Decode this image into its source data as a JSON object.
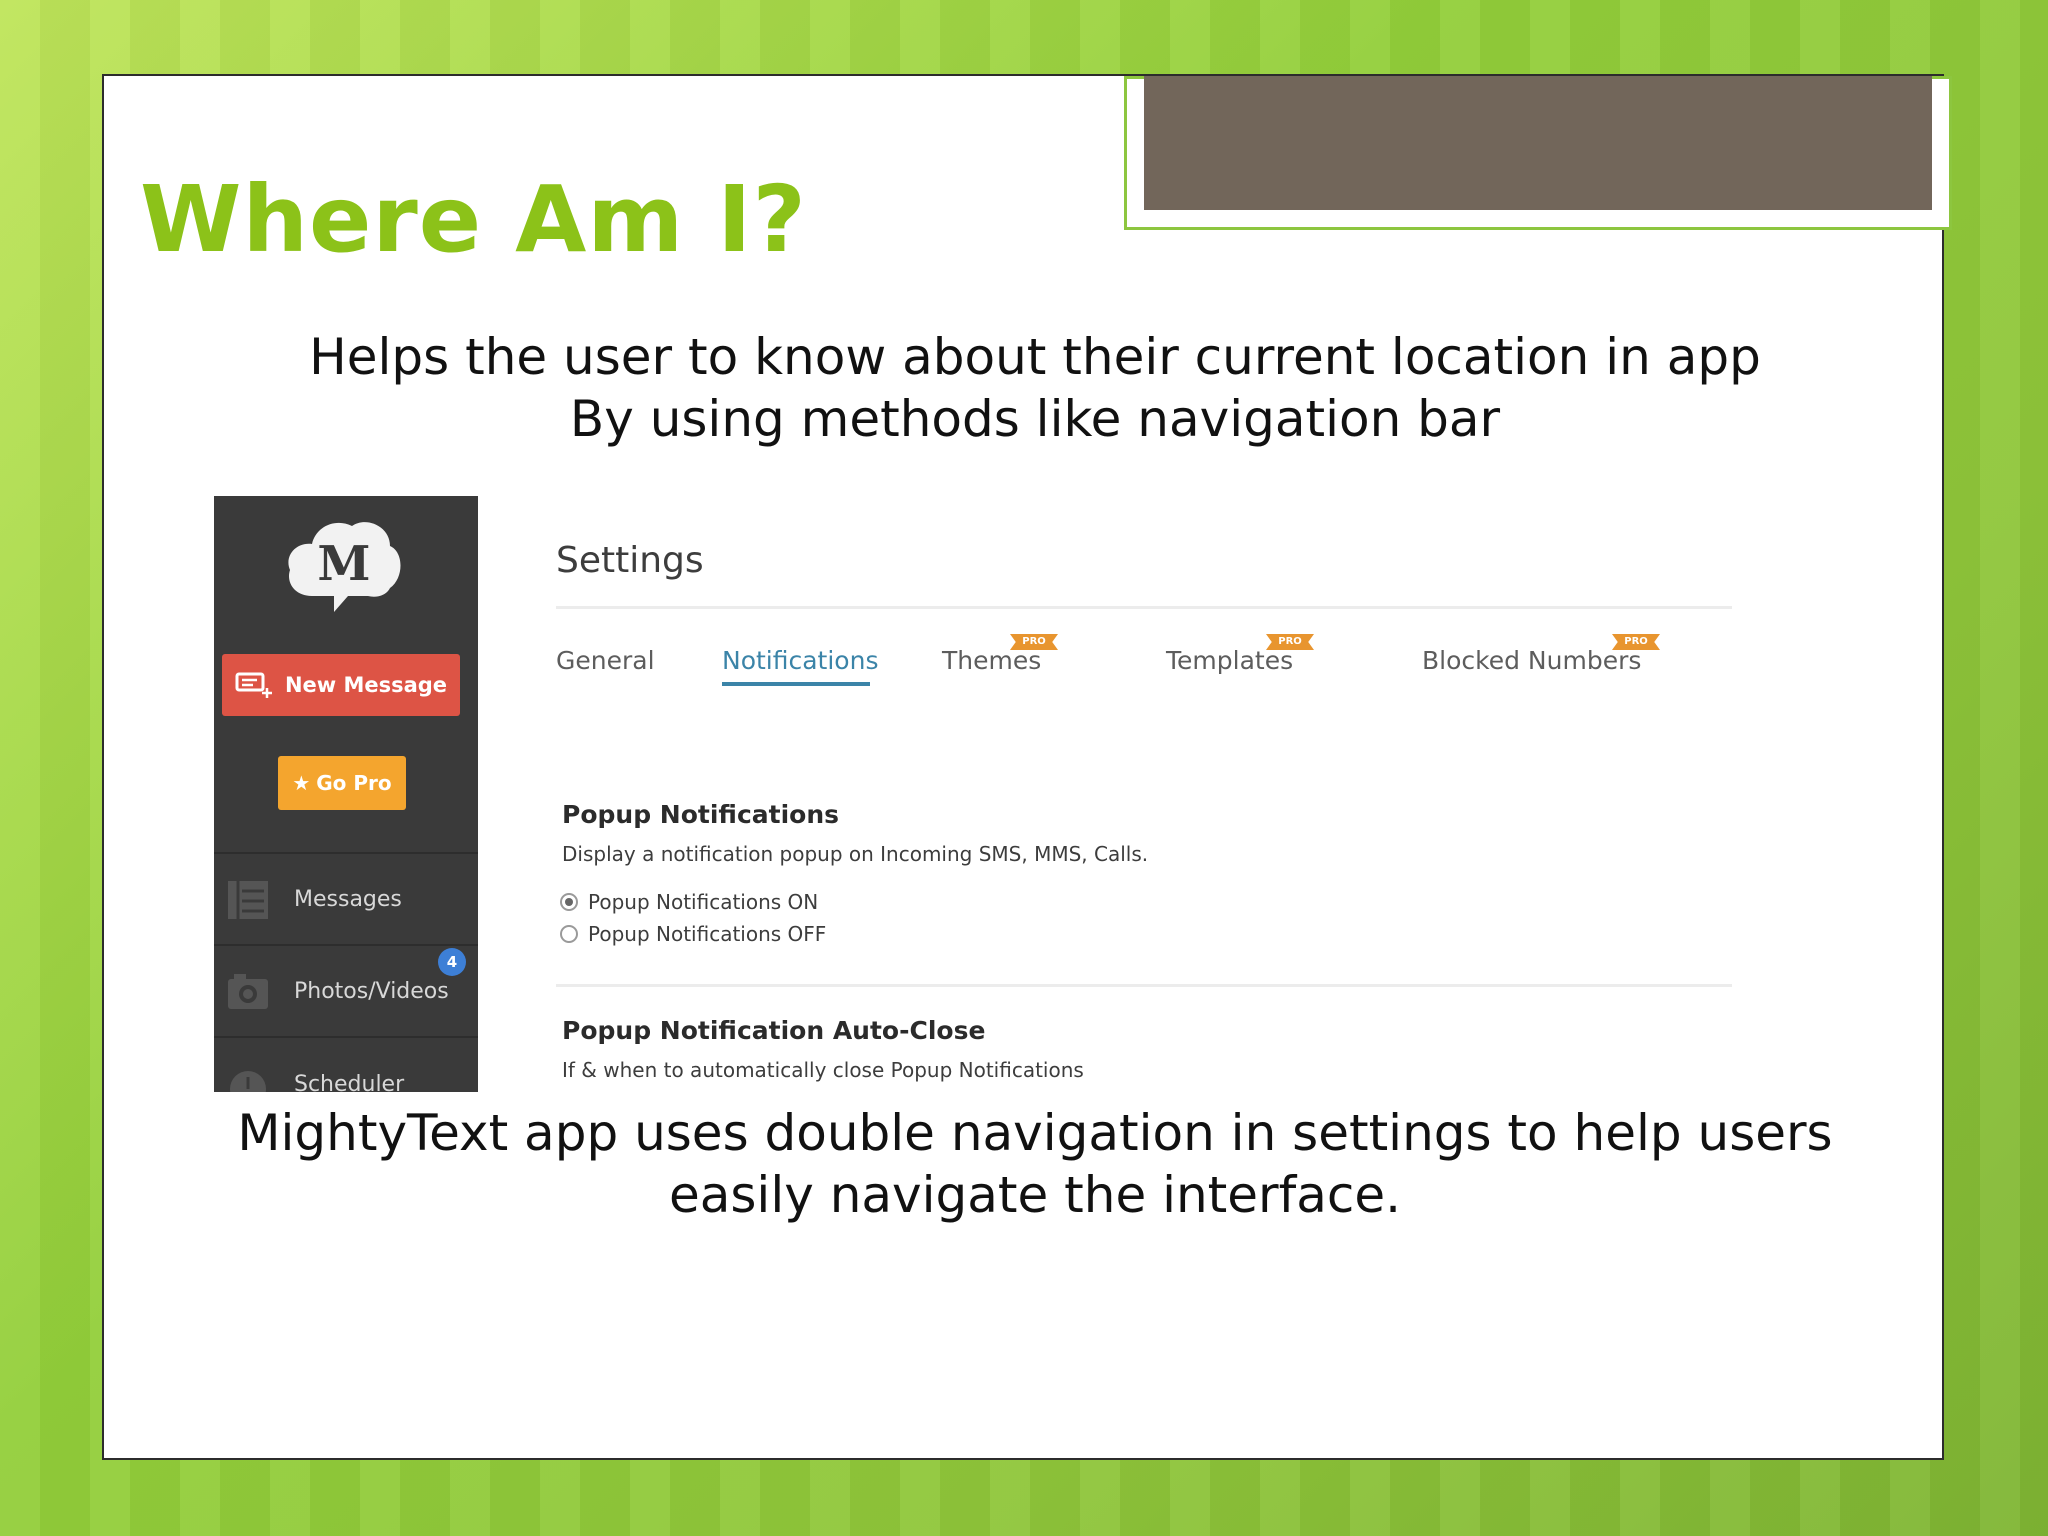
{
  "slide": {
    "title": "Where Am I?",
    "intro_lines": [
      "Helps the user to know about their current location in app",
      "By using methods like navigation bar"
    ],
    "caption_lines": [
      "MightyText app uses double navigation in settings to help users",
      "easily navigate the interface."
    ]
  },
  "app": {
    "logo_letter": "M",
    "new_message_label": "New Message",
    "go_pro_label": "Go Pro",
    "nav": [
      {
        "label": "Messages",
        "icon": "messages-icon"
      },
      {
        "label": "Photos/Videos",
        "icon": "camera-icon",
        "badge": "4"
      },
      {
        "label": "Scheduler",
        "icon": "clock-icon"
      }
    ],
    "settings_title": "Settings",
    "tabs": [
      {
        "label": "General",
        "active": false,
        "pro": false
      },
      {
        "label": "Notifications",
        "active": true,
        "pro": false
      },
      {
        "label": "Themes",
        "active": false,
        "pro": true
      },
      {
        "label": "Templates",
        "active": false,
        "pro": true
      },
      {
        "label": "Blocked Numbers",
        "active": false,
        "pro": true
      }
    ],
    "pro_tag": "PRO",
    "sections": [
      {
        "title": "Popup Notifications",
        "description": "Display a notification popup on Incoming SMS, MMS, Calls.",
        "options": [
          {
            "label": "Popup Notifications ON",
            "selected": true
          },
          {
            "label": "Popup Notifications OFF",
            "selected": false
          }
        ]
      },
      {
        "title": "Popup Notification Auto-Close",
        "description": "If & when to automatically close Popup Notifications"
      }
    ]
  },
  "colors": {
    "title_green": "#8cc219",
    "header_box": "#72665a",
    "new_message_red": "#dd5445",
    "go_pro_orange": "#f4a52e",
    "active_tab_blue": "#3b84a8",
    "sidebar_dark": "#3a3a3a"
  }
}
